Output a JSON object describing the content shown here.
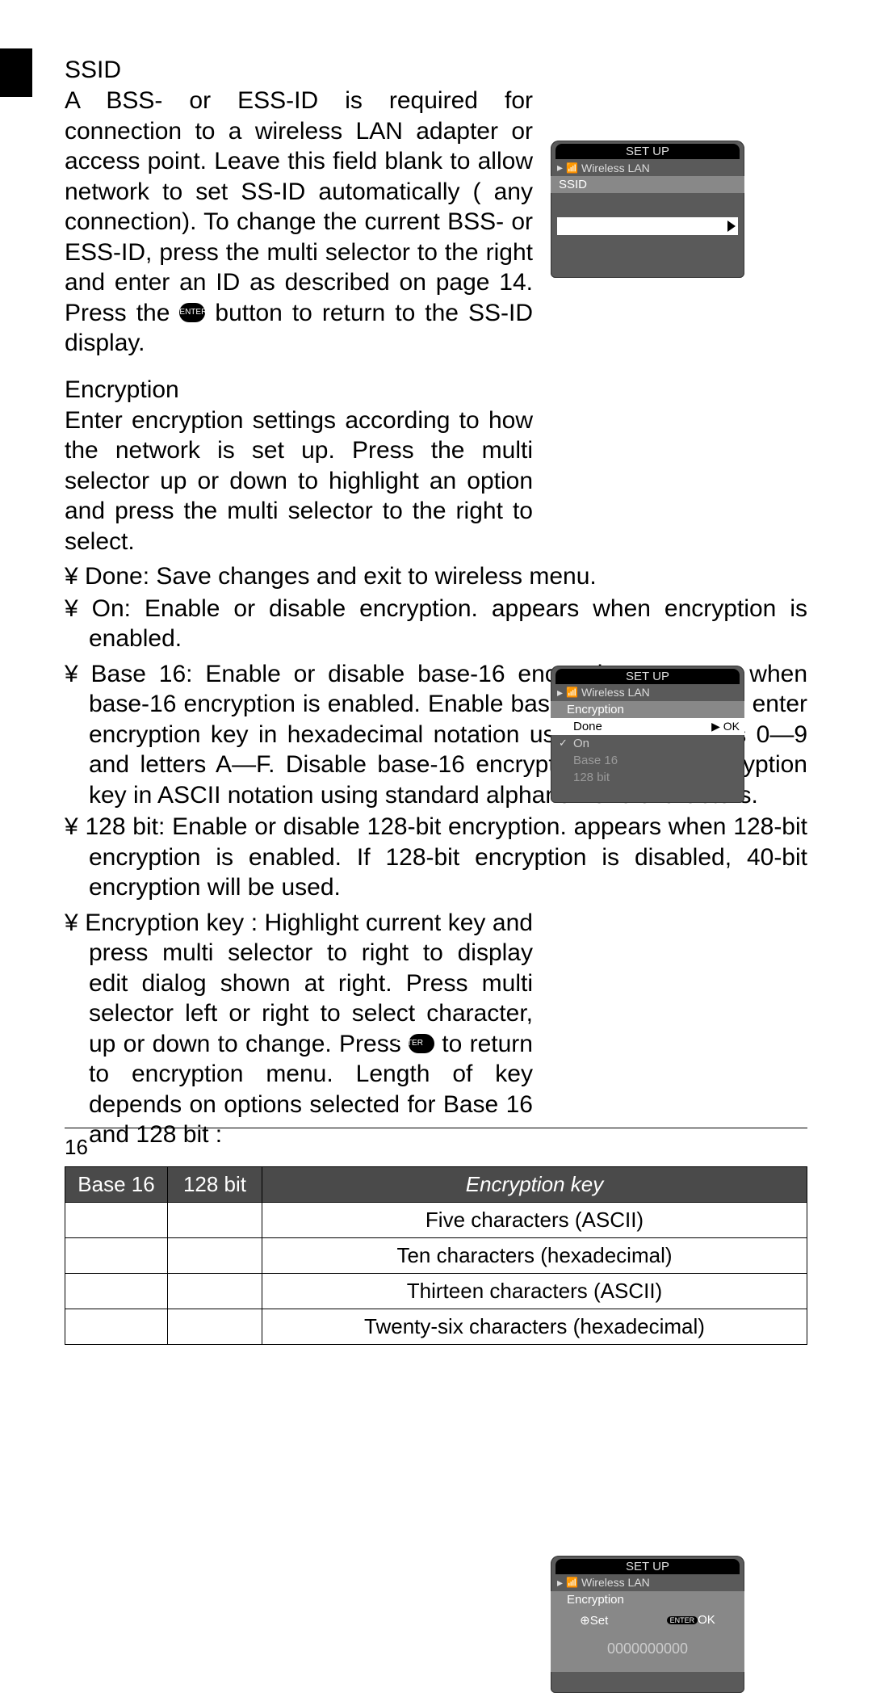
{
  "page_number": "16",
  "sections": {
    "ssid": {
      "title": "SSID",
      "body": "A BSS- or ESS-ID is required for connection to a wireless LAN adapter or access point.  Leave this field blank to allow network to set SS-ID automatically ( any  connection).  To change the current BSS- or ESS-ID, press the multi selector to the right and enter an ID as described on page 14.  Press the ",
      "body_tail": " button to return to the SS-ID display."
    },
    "encryption": {
      "title": "Encryption",
      "intro": "Enter encryption settings according to how the network is set up.  Press the multi selector up or down to highlight an option and press the multi selector to the right to select.",
      "items": {
        "done": "¥ Done: Save changes and exit to wireless menu.",
        "on": "¥ On: Enable or disable encryption.    appears when encryption is enabled.",
        "base16": "¥ Base 16: Enable or disable base-16 encryption.    appears when base-16 encryption is enabled.  Enable base-16 encryption to enter encryption key in hexadecimal notation using only numbers 0—9 and letters A—F.  Disable base-16 encryption to enter encryption key in ASCII notation using standard alphanumeric characters.",
        "b128": "¥ 128 bit: Enable or disable 128-bit encryption.    appears when 128-bit en­cryption is enabled.  If 128-bit encryption is disabled, 40-bit encryption will be used.",
        "key": "¥ Encryption key : Highlight current key and press multi selector to right to display edit dialog shown at right.  Press multi selector left or right to select character, up or down to change.  Press ",
        "key_tail": " to return to encryption menu.  Length of key depends on options selected for Base 16 and 128 bit :"
      }
    }
  },
  "screens": {
    "s1": {
      "setup": "SET  UP",
      "crumb": "Wireless LAN",
      "label": "SSID"
    },
    "s2": {
      "setup": "SET  UP",
      "crumb": "Wireless LAN",
      "label": "Encryption",
      "done": "Done",
      "ok": "OK",
      "on": "On",
      "base16": "Base 16",
      "b128": "128 bit"
    },
    "s3": {
      "setup": "SET  UP",
      "crumb": "Wireless LAN",
      "label": "Encryption",
      "set": "Set",
      "ok": "OK",
      "key": "0000000000"
    }
  },
  "enter_label": "ENTER",
  "table": {
    "headers": {
      "h1": "Base 16",
      "h2": "128 bit",
      "h3": "Encryption key"
    },
    "rows": [
      "Five characters (ASCII)",
      "Ten characters (hexadecimal)",
      "Thirteen characters (ASCII)",
      "Twenty-six characters (hexadecimal)"
    ]
  }
}
